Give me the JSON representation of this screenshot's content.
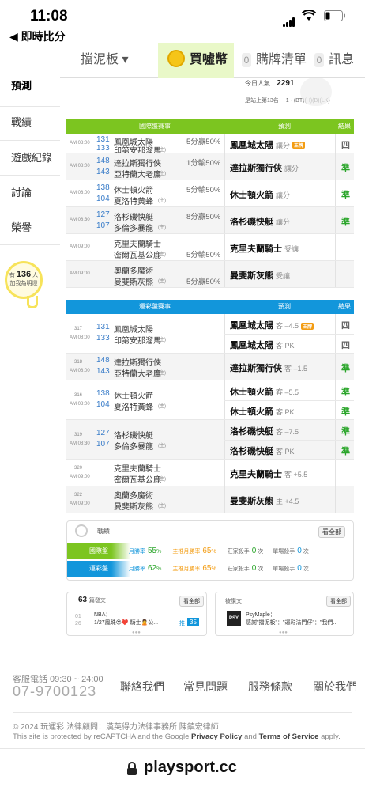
{
  "status": {
    "time": "11:08",
    "back_label": "◀ 即時比分"
  },
  "nav": {
    "board": "擋泥板 ▾",
    "buy": "買噓幣",
    "cart_count": "0",
    "cart": "購牌清單",
    "msg_count": "0",
    "msg": "訊息"
  },
  "visitors": {
    "label": "今日人氣",
    "count": "2291",
    "rank": "是站上第13名！ 1 - (BT)(H)(B)(LK)"
  },
  "sidebar": {
    "items": [
      "預測",
      "戰績",
      "遊戲紀錄",
      "討論",
      "榮譽"
    ],
    "bulb_prefix": "有",
    "bulb_count": "136",
    "bulb_unit": "人",
    "bulb_text": "加我為明燈"
  },
  "intl": {
    "header": "國際盤賽事",
    "pred_header": "預測",
    "result_header": "結果",
    "rows": [
      {
        "time": "AM 08:00",
        "n1": "131",
        "t1": "鳳凰城太陽",
        "n2": "133",
        "t2": "印第安那溜馬",
        "tag2": "(主)",
        "line": "5分贏50%",
        "pick": "鳳凰城太陽",
        "sub": "讓分",
        "tag": "王牌",
        "result": "四"
      },
      {
        "time": "AM 08:00",
        "n1": "148",
        "t1": "達拉斯獨行俠",
        "n2": "143",
        "t2": "亞特蘭大老鷹",
        "tag2": "(主)",
        "line": "1分輸50%",
        "pick": "達拉斯獨行俠",
        "sub": "讓分",
        "tag": "",
        "result": "準"
      },
      {
        "time": "AM 08:00",
        "n1": "138",
        "t1": "休士頓火箭",
        "n2": "104",
        "t2": "夏洛特黃蜂",
        "tag2": "(主)",
        "line": "5分輸50%",
        "pick": "休士頓火箭",
        "sub": "讓分",
        "tag": "",
        "result": "準"
      },
      {
        "time": "AM 08:30",
        "n1": "127",
        "t1": "洛杉磯快艇",
        "n2": "107",
        "t2": "多倫多暴龍",
        "tag2": "(主)",
        "line": "8分贏50%",
        "pick": "洛杉磯快艇",
        "sub": "讓分",
        "tag": "",
        "result": "準"
      },
      {
        "time": "AM 09:00",
        "n1": "",
        "t1": "克里夫蘭騎士",
        "n2": "",
        "t2": "密爾瓦基公鹿",
        "tag2": "(主)",
        "line": "5分輸50%",
        "pick": "克里夫蘭騎士",
        "sub": "受讓",
        "tag": "",
        "result": ""
      },
      {
        "time": "AM 09:00",
        "n1": "",
        "t1": "奧蘭多魔術",
        "n2": "",
        "t2": "曼斐斯灰熊",
        "tag2": "(主)",
        "line": "5分贏50%",
        "pick": "曼斐斯灰熊",
        "sub": "受讓",
        "tag": "",
        "result": ""
      }
    ]
  },
  "lottery": {
    "header": "運彩盤賽事",
    "pred_header": "預測",
    "result_header": "結果",
    "rows": [
      {
        "id": "317",
        "time": "AM 08:00",
        "n1": "131",
        "t1": "鳳凰城太陽",
        "n2": "133",
        "t2": "印第安那溜馬",
        "tag2": "(主)",
        "picks": [
          {
            "team": "鳳凰城太陽",
            "sub": "客 –4.5",
            "tag": "王牌",
            "result": "四"
          },
          {
            "team": "鳳凰城太陽",
            "sub": "客 PK",
            "tag": "",
            "result": "四"
          }
        ]
      },
      {
        "id": "318",
        "time": "AM 08:00",
        "n1": "148",
        "t1": "達拉斯獨行俠",
        "n2": "143",
        "t2": "亞特蘭大老鷹",
        "tag2": "(主)",
        "picks": [
          {
            "team": "達拉斯獨行俠",
            "sub": "客 –1.5",
            "tag": "",
            "result": "準"
          }
        ]
      },
      {
        "id": "316",
        "time": "AM 08:00",
        "n1": "138",
        "t1": "休士頓火箭",
        "n2": "104",
        "t2": "夏洛特黃蜂",
        "tag2": "(主)",
        "picks": [
          {
            "team": "休士頓火箭",
            "sub": "客 –5.5",
            "tag": "",
            "result": "準"
          },
          {
            "team": "休士頓火箭",
            "sub": "客 PK",
            "tag": "",
            "result": "準"
          }
        ]
      },
      {
        "id": "319",
        "time": "AM 08:30",
        "n1": "127",
        "t1": "洛杉磯快艇",
        "n2": "107",
        "t2": "多倫多暴龍",
        "tag2": "(主)",
        "picks": [
          {
            "team": "洛杉磯快艇",
            "sub": "客 –7.5",
            "tag": "",
            "result": "準"
          },
          {
            "team": "洛杉磯快艇",
            "sub": "客 PK",
            "tag": "",
            "result": "準"
          }
        ]
      },
      {
        "id": "320",
        "time": "AM 09:00",
        "n1": "",
        "t1": "克里夫蘭騎士",
        "n2": "",
        "t2": "密爾瓦基公鹿",
        "tag2": "(主)",
        "picks": [
          {
            "team": "克里夫蘭騎士",
            "sub": "客 +5.5",
            "tag": "",
            "result": ""
          }
        ]
      },
      {
        "id": "322",
        "time": "AM 09:00",
        "n1": "",
        "t1": "奧蘭多魔術",
        "n2": "",
        "t2": "曼斐斯灰熊",
        "tag2": "(主)",
        "picks": [
          {
            "team": "曼斐斯灰熊",
            "sub": "主 +4.5",
            "tag": "",
            "result": ""
          }
        ]
      }
    ]
  },
  "record": {
    "title": "戰績",
    "view_all": "看全部",
    "rows": [
      {
        "label": "國際盤",
        "monthly": "月勝率",
        "monthly_val": "55",
        "main": "主推月勝率",
        "main_val": "65",
        "home": "莊家殺手",
        "home_val": "0",
        "home_unit": "次",
        "single": "單場殺手",
        "single_val": "0",
        "single_unit": "次"
      },
      {
        "label": "運彩盤",
        "monthly": "月勝率",
        "monthly_val": "62",
        "main": "主推月勝率",
        "main_val": "65",
        "home": "莊家殺手",
        "home_val": "0",
        "home_unit": "次",
        "single": "單場殺手",
        "single_val": "0",
        "single_unit": "次"
      }
    ],
    "percent": "%"
  },
  "posts": {
    "count": "63",
    "count_label": "篇發文",
    "view_all": "看全部",
    "date_m": "01",
    "date_d": "26",
    "title": "NBA：",
    "line": "1/27鳳珠😍❤️ 騎士🙎公...",
    "tag": "推",
    "push": "35"
  },
  "mentions": {
    "title": "被讚文",
    "view_all": "看全部",
    "avatar": "PSY",
    "name": "PsyMaple：",
    "line": "感謝\"擋泥板\"：\"運彩法門仔\"：\"我們..."
  },
  "footer": {
    "phone_label": "客服電話 09:30 ~ 24:00",
    "phone": "07-9700123",
    "links": [
      "聯絡我們",
      "常見問題",
      "服務條款",
      "關於我們"
    ],
    "copyright": "© 2024 玩運彩 法律顧問：漢英得力法律事務所 陳鎮宏律師",
    "recaptcha_a": "This site is protected by reCAPTCHA and the Google",
    "privacy": "Privacy Policy",
    "and": "and",
    "terms": "Terms of Service",
    "apply": "apply."
  },
  "url": "playsport.cc",
  "colors": {
    "green": "#7cc520",
    "blue": "#1296db",
    "orange": "#f39c12"
  }
}
